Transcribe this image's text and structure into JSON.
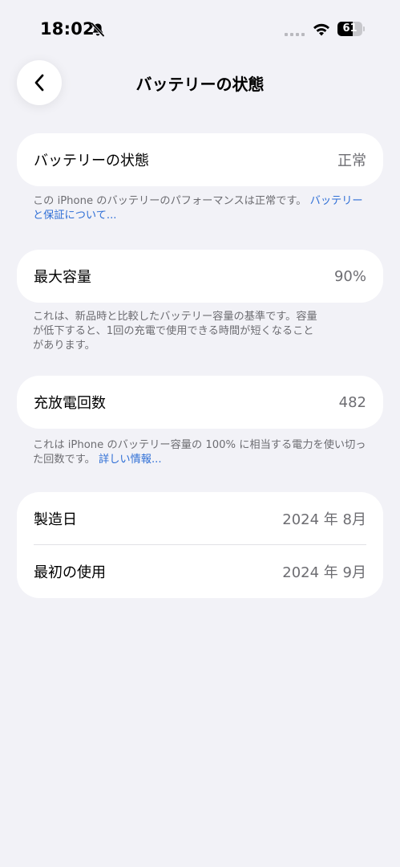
{
  "status_bar": {
    "time": "18:02",
    "battery_level": "61",
    "battery_fraction": 0.61,
    "icons": [
      "bell-slash-icon",
      "cellular-signal-icon",
      "wifi-icon",
      "battery-icon"
    ]
  },
  "nav": {
    "back_icon": "chevron-left-icon",
    "title": "バッテリーの状態"
  },
  "battery_health": {
    "label": "バッテリーの状態",
    "value": "正常",
    "footnote": "この iPhone のバッテリーのパフォーマンスは正常です。",
    "footnote_link": "バッテリーと保証について..."
  },
  "max_capacity": {
    "label": "最大容量",
    "value": "90%",
    "footnote_line1": "これは、新品時と比較したバッテリー容量の基準です。容量",
    "footnote_line2": "が低下すると、1回の充電で使用できる時間が短くなること",
    "footnote_line3": "があります。"
  },
  "cycle_count": {
    "label": "充放電回数",
    "value": "482",
    "footnote": "これは iPhone のバッテリー容量の 100% に相当する電力を使い切った回数です。",
    "footnote_link": "詳しい情報..."
  },
  "dates": {
    "manufactured_label": "製造日",
    "manufactured_value": "2024 年 8月",
    "first_use_label": "最初の使用",
    "first_use_value": "2024 年 9月"
  },
  "colors": {
    "background": "#f2f2f7",
    "card": "#ffffff",
    "secondary_text": "#6d6d72",
    "link": "#2f6fd6"
  }
}
